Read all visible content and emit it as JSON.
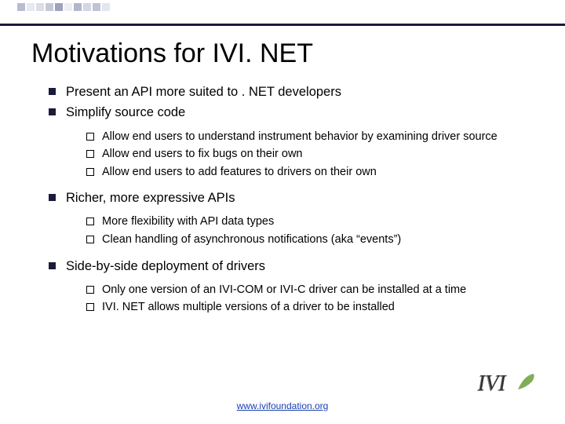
{
  "deco_colors": [
    "#b8bccf",
    "#e8e9f0",
    "#dcdde7",
    "#c5c8d8",
    "#9ea3bd",
    "#eceef4",
    "#b3b7cc",
    "#d4d6e2",
    "#c0c3d5",
    "#e4e5ee"
  ],
  "title": "Motivations for IVI. NET",
  "bullets": [
    {
      "text": "Present an API more suited to . NET developers",
      "children": []
    },
    {
      "text": "Simplify source code",
      "children": [
        "Allow end users to understand instrument behavior by examining driver source",
        "Allow end users to fix bugs on their own",
        "Allow end users to add features to drivers on their own"
      ]
    },
    {
      "text": "Richer, more expressive APIs",
      "children": [
        "More flexibility with API data types",
        "Clean handling of asynchronous notifications (aka “events”)"
      ]
    },
    {
      "text": "Side-by-side deployment of drivers",
      "children": [
        "Only one version of an IVI-COM or IVI-C driver can be installed at a time",
        "IVI. NET allows multiple versions of a driver to be installed"
      ]
    }
  ],
  "footer_link": "www.ivifoundation.org",
  "logo_alt": "IVI"
}
